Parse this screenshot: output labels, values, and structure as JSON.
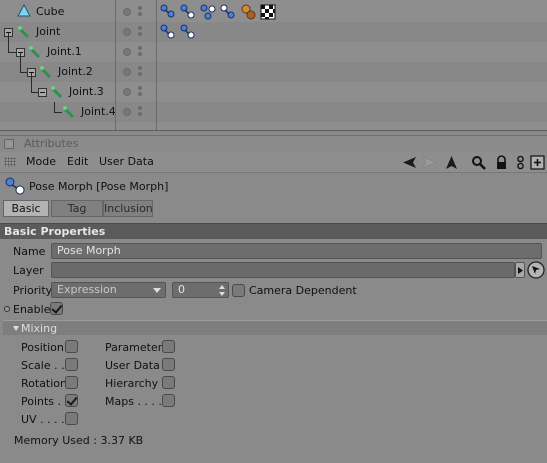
{
  "object_manager": {
    "objects": [
      {
        "name": "Cube",
        "icon": "cube-icon",
        "tags": [
          "pose-morph-tag",
          "pose-morph-tag",
          "pose-morph-tag",
          "pose-morph-tag",
          "material-spheres-tag",
          "checker-texture-tag"
        ]
      },
      {
        "name": "Joint",
        "icon": "joint-icon",
        "tags": [
          "pose-morph-tag",
          "pose-morph-tag"
        ]
      },
      {
        "name": "Joint.1",
        "icon": "joint-icon",
        "tags": []
      },
      {
        "name": "Joint.2",
        "icon": "joint-icon",
        "tags": []
      },
      {
        "name": "Joint.3",
        "icon": "joint-icon",
        "tags": []
      },
      {
        "name": "Joint.4",
        "icon": "joint-icon",
        "tags": []
      }
    ]
  },
  "attributes": {
    "header_title": "Attributes",
    "menu": [
      "Mode",
      "Edit",
      "User Data"
    ],
    "toolbar_icons": [
      "arrow-left-icon",
      "arrow-right-icon",
      "arrow-up-icon",
      "search-icon",
      "lock-icon",
      "link-icon",
      "new-panel-icon"
    ],
    "object_title": "Pose Morph [Pose Morph]",
    "tabs": [
      "Basic",
      "Tag",
      "Inclusion"
    ],
    "active_tab": "Basic",
    "section_title": "Basic Properties",
    "name_label": "Name",
    "name_value": "Pose Morph",
    "layer_label": "Layer",
    "layer_value": "",
    "priority_label": "Priority",
    "priority_value": "Expression",
    "priority_number": "0",
    "camera_dependent_label": "Camera Dependent",
    "camera_dependent_checked": false,
    "enable_label": "Enable",
    "enable_checked": true,
    "mixing_title": "Mixing",
    "mixing_left": [
      {
        "label": "Position",
        "checked": false
      },
      {
        "label": "Scale . .",
        "checked": false
      },
      {
        "label": "Rotation",
        "checked": false
      },
      {
        "label": "Points . .",
        "checked": true
      },
      {
        "label": "UV . . . .",
        "checked": false
      }
    ],
    "mixing_right": [
      {
        "label": "Parameters",
        "checked": false
      },
      {
        "label": "User Data",
        "checked": false
      },
      {
        "label": "Hierarchy",
        "checked": false
      },
      {
        "label": "Maps . . . .",
        "checked": false
      }
    ],
    "memory_label": "Memory Used : 3.37 KB"
  },
  "colors": {
    "background": "#8a8a8a",
    "section_header": "#5b5b5b",
    "field_bg": "#6d6d6d"
  }
}
